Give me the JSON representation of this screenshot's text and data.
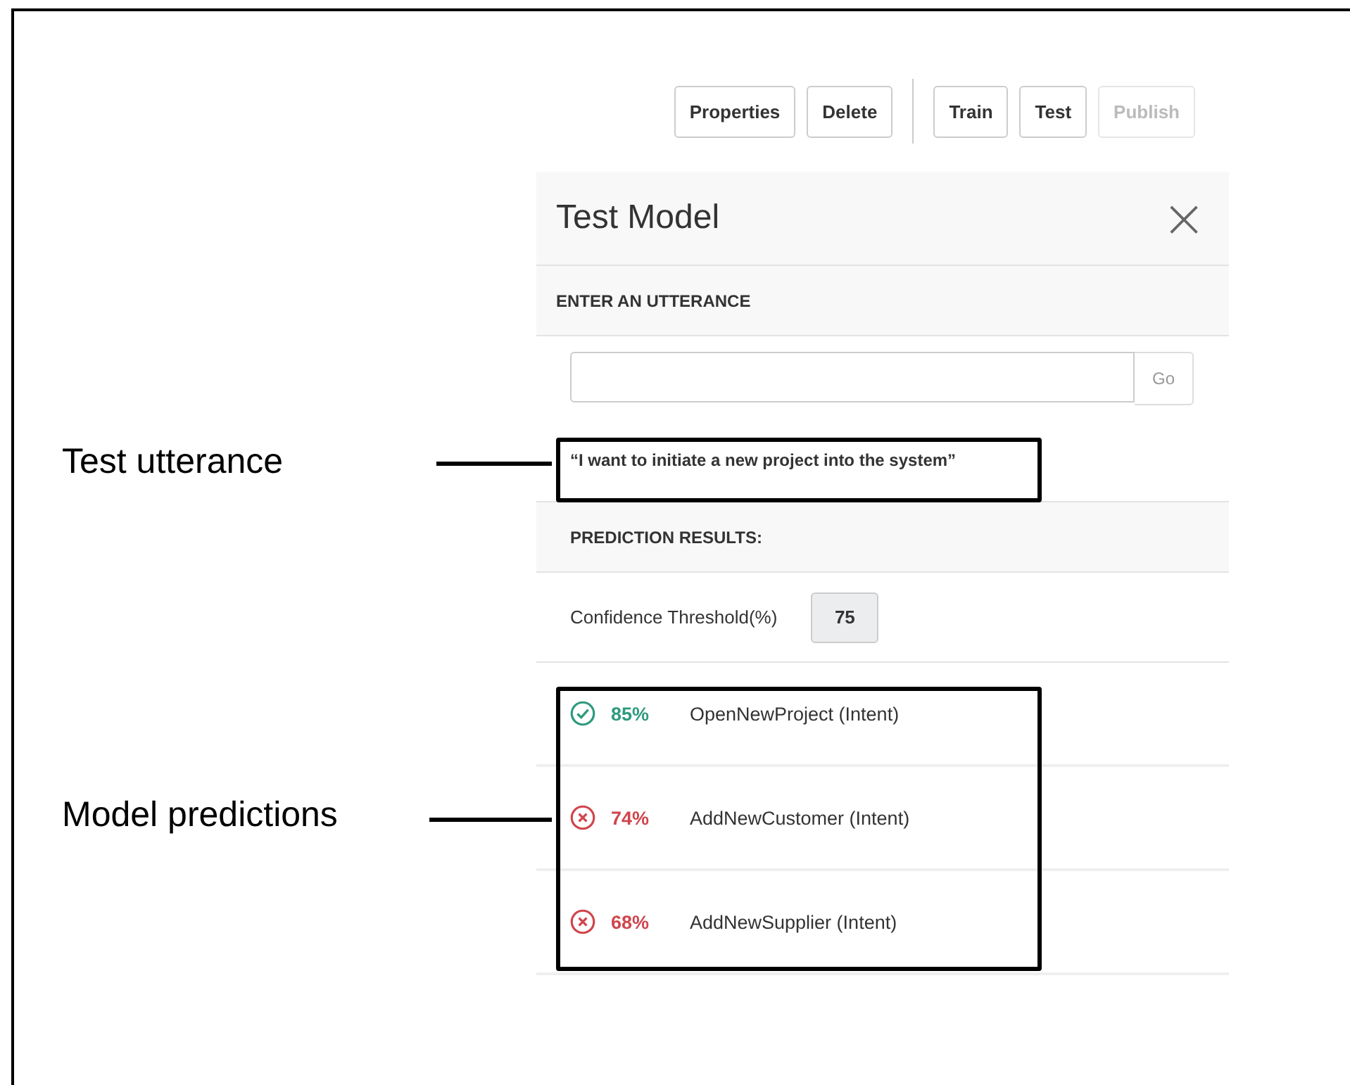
{
  "toolbar": {
    "left_buttons": [
      {
        "label": "Properties",
        "disabled": false
      },
      {
        "label": "Delete",
        "disabled": false
      }
    ],
    "right_buttons": [
      {
        "label": "Train",
        "disabled": false
      },
      {
        "label": "Test",
        "disabled": false
      },
      {
        "label": "Publish",
        "disabled": true
      }
    ]
  },
  "panel": {
    "title": "Test Model",
    "close": "×",
    "utterance_label": "ENTER AN UTTERANCE",
    "go_button": "Go",
    "utterance": "“I want to initiate a new project into the system”",
    "results_label": "PREDICTION RESULTS:",
    "threshold_label": "Confidence Threshold(%)",
    "threshold_value": "75",
    "predictions": [
      {
        "matched": true,
        "percent": "85%",
        "intent": "OpenNewProject (Intent)"
      },
      {
        "matched": false,
        "percent": "74%",
        "intent": "AddNewCustomer (Intent)"
      },
      {
        "matched": false,
        "percent": "68%",
        "intent": "AddNewSupplier (Intent)"
      }
    ]
  },
  "annotations": [
    {
      "label": "Test utterance"
    },
    {
      "label": "Model predictions"
    }
  ]
}
